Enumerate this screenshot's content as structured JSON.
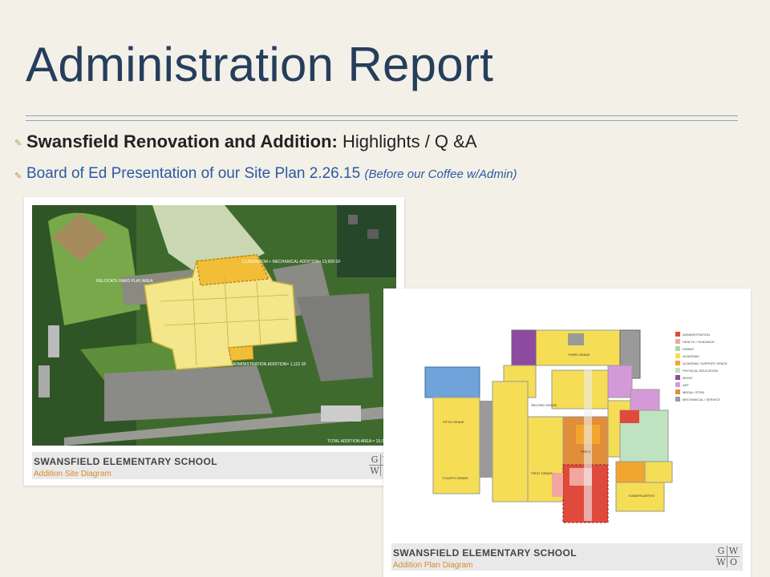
{
  "slide": {
    "title": "Administration Report",
    "bullets": [
      {
        "bold": "Swansfield Renovation and Addition:",
        "rest": "Highlights / Q &A"
      },
      {
        "text": "Board of Ed Presentation of our Site Plan 2.26.15",
        "italic": "(Before our Coffee w/Admin)"
      }
    ]
  },
  "site_diagram": {
    "school_name": "SWANSFIELD ELEMENTARY SCHOOL",
    "caption": "Addition Site Diagram",
    "labels": {
      "relocate": "RELOCATE HARD PLAY AREA",
      "classroom": "CLASSROOM + MECHANICAL ADDITION= 13,909 SF",
      "administration": "ADMINISTRATION ADDITION= 1,122 SF",
      "total": "TOTAL ADDITION AREA = 15,030 SF"
    },
    "logo": [
      "G",
      "W",
      "W",
      "O"
    ]
  },
  "plan_diagram": {
    "school_name": "SWANSFIELD ELEMENTARY SCHOOL",
    "caption": "Addition Plan Diagram",
    "room_labels": {
      "third": "THIRD GRADE",
      "second": "SECOND GRADE",
      "fifth": "FIFTH GRADE",
      "fourth": "FOURTH GRADE",
      "first": "FIRST GRADE",
      "pre": "PRE-K",
      "kinder": "KINDERGARTEN"
    },
    "legend": [
      {
        "label": "ADMINISTRATION",
        "color": "#e04a3c"
      },
      {
        "label": "HEALTH / GUIDANCE",
        "color": "#f2a6a0"
      },
      {
        "label": "DINING",
        "color": "#a9d8a8"
      },
      {
        "label": "ACADEMIC",
        "color": "#f5dd55"
      },
      {
        "label": "ACADEMIC SUPPORT SPACE",
        "color": "#f2a62f"
      },
      {
        "label": "PHYSICAL EDUCATION",
        "color": "#bfe3c0"
      },
      {
        "label": "MUSIC",
        "color": "#8d4aa0"
      },
      {
        "label": "ART",
        "color": "#d49ad8"
      },
      {
        "label": "MEDIA / STEM",
        "color": "#e08e3a"
      },
      {
        "label": "MECHANICAL / SERVICE",
        "color": "#9a9a9a"
      }
    ],
    "logo": [
      "G",
      "W",
      "W",
      "O"
    ]
  }
}
